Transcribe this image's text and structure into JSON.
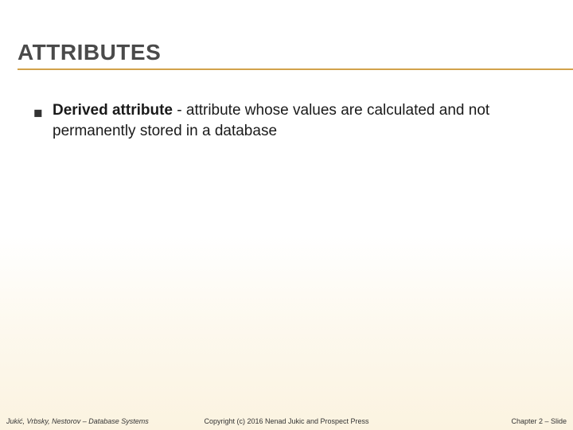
{
  "title": "ATTRIBUTES",
  "bullet": {
    "term": "Derived attribute",
    "separator": " - ",
    "definition": "attribute whose values are calculated and not permanently stored in a database"
  },
  "footer": {
    "left": "Jukić, Vrbsky, Nestorov – Database Systems",
    "center": "Copyright (c) 2016 Nenad Jukic and Prospect Press",
    "right": "Chapter 2 – Slide"
  }
}
